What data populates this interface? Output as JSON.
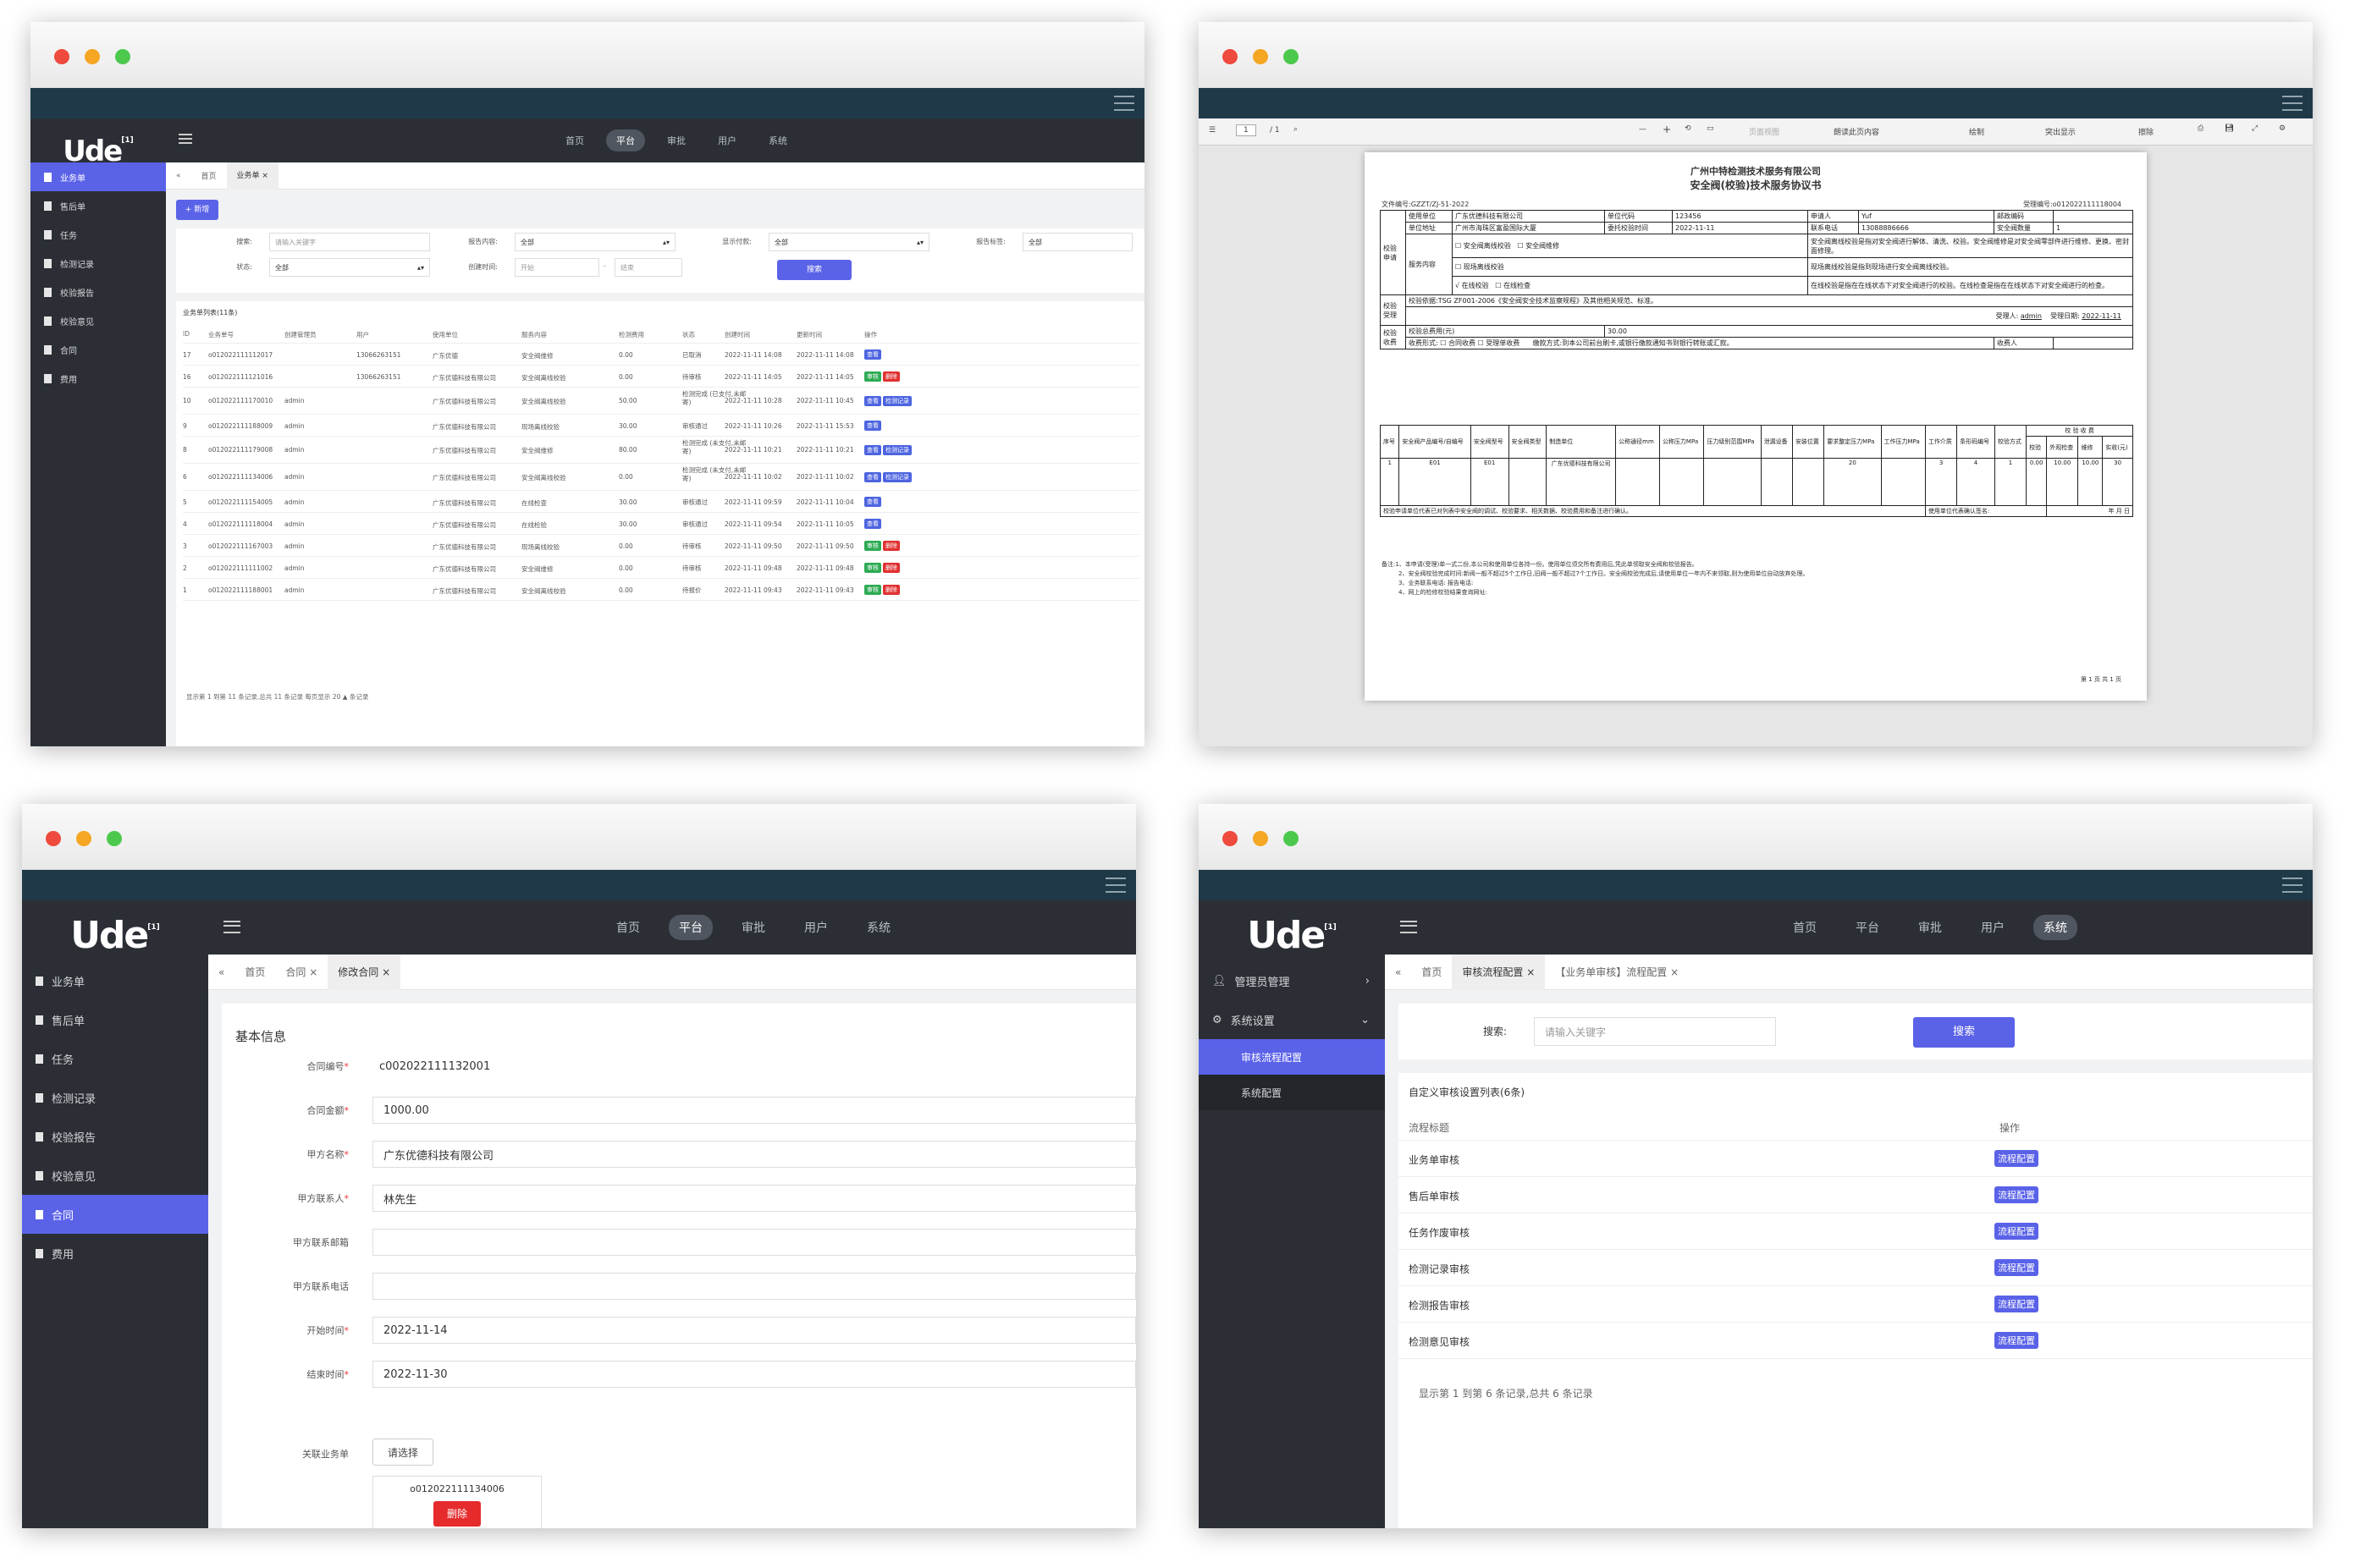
{
  "brand": {
    "logo": "Ude",
    "logo_sup": "[1]"
  },
  "nav": [
    "首页",
    "平台",
    "审批",
    "用户",
    "系统"
  ],
  "w1": {
    "sidebar": [
      "业务单",
      "售后单",
      "任务",
      "检测记录",
      "校验报告",
      "校验意见",
      "合同",
      "费用"
    ],
    "crumb": {
      "home": "首页",
      "tab": "业务单"
    },
    "add": "+ 新增",
    "filters": {
      "search": "搜索:",
      "search_ph": "请输入关键字",
      "report": "报告内容:",
      "report_v": "全部",
      "show": "显示付款:",
      "show_v": "全部",
      "report_label": "报告标签:",
      "report_label_v": "全部",
      "status": "状态:",
      "status_v": "全部",
      "created": "创建时间:",
      "start_ph": "开始",
      "end_ph": "结束"
    },
    "search_btn": "搜索",
    "list_title": "业务单列表(11条)",
    "cols": [
      "ID",
      "业务单号",
      "创建管理员",
      "用户",
      "使用单位",
      "服务内容",
      "检测费用",
      "状态",
      "创建时间",
      "更新时间",
      "操作"
    ],
    "rows": [
      [
        "17",
        "o012022111112017",
        "",
        "13066263151",
        "广东优德",
        "安全阀维修",
        "0.00",
        "已取消",
        "2022-11-11 14:08",
        "2022-11-11 14:08",
        "b"
      ],
      [
        "16",
        "o012022111121016",
        "",
        "13066263151",
        "广东优德科技有限公司",
        "安全阀离线校验",
        "0.00",
        "待审核",
        "2022-11-11 14:05",
        "2022-11-11 14:05",
        "gr"
      ],
      [
        "10",
        "o012022111170010",
        "admin",
        "",
        "广东优德科技有限公司",
        "安全阀离线校验",
        "50.00",
        "检测完成 (已支付,未邮寄)",
        "2022-11-11 10:28",
        "2022-11-11 10:45",
        "bb"
      ],
      [
        "9",
        "o012022111188009",
        "admin",
        "",
        "广东优德科技有限公司",
        "现场离线校验",
        "30.00",
        "审核通过",
        "2022-11-11 10:26",
        "2022-11-11 15:53",
        "b"
      ],
      [
        "8",
        "o012022111179008",
        "admin",
        "",
        "广东优德科技有限公司",
        "安全阀维修",
        "80.00",
        "检测完成 (未支付,未邮寄)",
        "2022-11-11 10:21",
        "2022-11-11 10:21",
        "bb"
      ],
      [
        "6",
        "o012022111134006",
        "admin",
        "",
        "广东优德科技有限公司",
        "安全阀离线校验",
        "0.00",
        "检测完成 (未支付,未邮寄)",
        "2022-11-11 10:02",
        "2022-11-11 10:02",
        "bb"
      ],
      [
        "5",
        "o012022111154005",
        "admin",
        "",
        "广东优德科技有限公司",
        "在线检查",
        "30.00",
        "审核通过",
        "2022-11-11 09:59",
        "2022-11-11 10:04",
        "b"
      ],
      [
        "4",
        "o012022111118004",
        "admin",
        "",
        "广东优德科技有限公司",
        "在线检验",
        "30.00",
        "审核通过",
        "2022-11-11 09:54",
        "2022-11-11 10:05",
        "b"
      ],
      [
        "3",
        "o012022111167003",
        "admin",
        "",
        "广东优德科技有限公司",
        "现场离线校验",
        "0.00",
        "待审核",
        "2022-11-11 09:50",
        "2022-11-11 09:50",
        "gr"
      ],
      [
        "2",
        "o012022111111002",
        "admin",
        "",
        "广东优德科技有限公司",
        "安全阀维修",
        "0.00",
        "待审核",
        "2022-11-11 09:48",
        "2022-11-11 09:48",
        "gr"
      ],
      [
        "1",
        "o012022111188001",
        "admin",
        "",
        "广东优德科技有限公司",
        "安全阀离线校验",
        "0.00",
        "待报价",
        "2022-11-11 09:43",
        "2022-11-11 09:43",
        "gr"
      ]
    ],
    "actions": {
      "view": "查看",
      "del": "删除",
      "rec": "检测记录",
      "review": "审核"
    },
    "footer": "显示第 1 到第 11 条记录,总共 11 条记录 每页显示 20 ▲ 条记录"
  },
  "w2": {
    "page": "1",
    "pages": "/ 1",
    "tools": [
      "页面视图",
      "朗读此页内容",
      "绘制",
      "突出显示",
      "擦除"
    ],
    "title1": "广州中特检测技术服务有限公司",
    "title2": "安全阀(校验)技术服务协议书",
    "fileno": "文件编号:GZZT/ZJ-51-2022",
    "acceptno": "受理编号:o012022111118004",
    "unit": "使用单位",
    "unit_v": "广东优德科技有限公司",
    "code": "单位代码",
    "code_v": "123456",
    "applicant": "申请人",
    "applicant_v": "Yuf",
    "zip": "邮政编码",
    "addr": "单位地址",
    "addr_v": "广州市海珠区富盈国际大厦",
    "entrust": "委托校验时间",
    "entrust_v": "2022-11-11",
    "phone": "联系电话",
    "phone_v": "13088886666",
    "qty": "安全阀数量",
    "qty_v": "1",
    "apply": "校验申请",
    "svc": "服务内容",
    "s1": "安全阀离线校验",
    "s2": "安全阀维修",
    "s3": "现场离线校验",
    "s4": "√ 在线校验",
    "s5": "在线检查",
    "d1": "安全阀离线校验是指对安全阀进行解体、清洗、校验。安全阀维修是对安全阀零部件进行维修、更换、密封面修理。",
    "d2": "现场离线校验是指到现场进行安全阀离线校验。",
    "d3": "在线校验是指在在线状态下对安全阀进行的校验。在线检查是指在在线状态下对安全阀进行的检查。",
    "accept": "校验受理",
    "basis": "校验依据:TSG ZF001-2006《安全阀安全技术监察规程》及其他相关规范、标准。",
    "receiver": "受理人:",
    "receiver_v": "admin",
    "acc_date": "受理日期:",
    "acc_date_v": "2022-11-11",
    "fee": "校验收费",
    "fee_total": "校验总费用(元)",
    "fee_total_v": "30.00",
    "fee_form": "收费形式:",
    "f1": "合同收费",
    "f2": "受理单收费",
    "pay": "缴款方式:到本公司前台刷卡,或银行缴款通知书到银行转账或汇款。",
    "payee": "收费人",
    "cols": [
      "序号",
      "安全阀产品编号/自编号",
      "安全阀型号",
      "安全阀类型",
      "制造单位",
      "公称通径mm",
      "公称压力MPa",
      "压力级别范围MPa",
      "泄漏设备",
      "安装位置",
      "要求整定压力MPa",
      "工作压力MPa",
      "工作介质",
      "条形码编号",
      "校验方式",
      "校验",
      "外观检查",
      "维修",
      "实收(元)"
    ],
    "fee_head": "校 验 收 费",
    "row": [
      "1",
      "E01",
      "E01",
      "",
      "广东优德科技有限公司",
      "",
      "",
      "",
      "",
      "",
      "20",
      "",
      "3",
      "4",
      "1",
      "0.00",
      "10.00",
      "10.00",
      "30"
    ],
    "confirm": "校验申请单位代表已对列表中安全阀的调试、校验要求、相关数据、校验费用和备注进行确认。",
    "sign": "使用单位代表确认签名:",
    "ymd": "年    月    日",
    "notes": [
      "备注:1、本申请(受理)单一式二份,本公司和使用单位各持一份。使用单位须交所有费用后,凭此单领取安全阀和校验报告。",
      "2、安全阀校验完成时间:新阀一般不超过5个工作日,旧阀一般不超过7个工作日。安全阀校验完成后,请使用单位一年内不来领取,则为使用单位自动放弃处理。",
      "3、业务联系电话:           报告电话:",
      "4、网上的检修校验结果查询网址:"
    ],
    "pageinfo": "第 1 页 共 1 页"
  },
  "w3": {
    "sidebar": [
      "业务单",
      "售后单",
      "任务",
      "检测记录",
      "校验报告",
      "校验意见",
      "合同",
      "费用"
    ],
    "crumb": [
      "首页",
      "合同",
      "修改合同"
    ],
    "section": "基本信息",
    "fields": [
      {
        "label": "合同编号",
        "req": true,
        "value": "c002022111132001",
        "box": false
      },
      {
        "label": "合同金额",
        "req": true,
        "value": "1000.00",
        "box": true
      },
      {
        "label": "甲方名称",
        "req": true,
        "value": "广东优德科技有限公司",
        "box": true
      },
      {
        "label": "甲方联系人",
        "req": true,
        "value": "林先生",
        "box": true
      },
      {
        "label": "甲方联系邮箱",
        "req": false,
        "value": "",
        "box": true
      },
      {
        "label": "甲方联系电话",
        "req": false,
        "value": "",
        "box": true
      },
      {
        "label": "开始时间",
        "req": true,
        "value": "2022-11-14",
        "box": true
      },
      {
        "label": "结束时间",
        "req": true,
        "value": "2022-11-30",
        "box": true
      }
    ],
    "link_label": "关联业务单",
    "choose": "请选择",
    "linked": "o012022111134006",
    "del": "删除"
  },
  "w4": {
    "sidebar": [
      {
        "label": "管理员管理",
        "arrow": "›"
      },
      {
        "label": "系统设置",
        "arrow": "⌄"
      }
    ],
    "sub": [
      "审核流程配置",
      "系统配置"
    ],
    "crumb": [
      "首页",
      "审核流程配置",
      "【业务单审核】流程配置"
    ],
    "search_label": "搜索:",
    "search_ph": "请输入关键字",
    "search_btn": "搜索",
    "list_title": "自定义审核设置列表(6条)",
    "col1": "流程标题",
    "col2": "操作",
    "rows": [
      "业务单审核",
      "售后单审核",
      "任务作废审核",
      "检测记录审核",
      "检测报告审核",
      "检测意见审核"
    ],
    "action": "流程配置",
    "footer": "显示第 1 到第 6 条记录,总共 6 条记录"
  }
}
